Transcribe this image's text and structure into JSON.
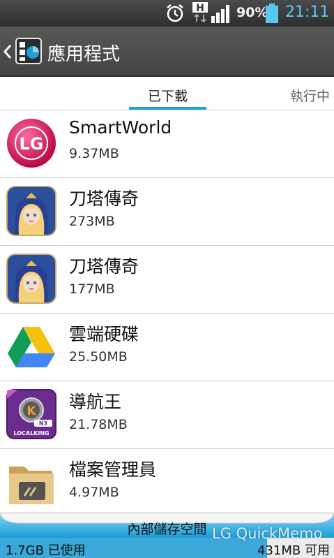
{
  "status_bar": {
    "battery_percent": "90%",
    "battery_level": 0.9,
    "time": "21:11",
    "network_label": "H",
    "icons": [
      "alarm-icon",
      "network-h-icon",
      "signal-icon",
      "battery-icon"
    ],
    "time_color": "#59c8ee"
  },
  "header": {
    "title": "應用程式",
    "icons": [
      "back-icon",
      "app-manager-icon"
    ]
  },
  "tabs": [
    {
      "label": "已下載",
      "selected": true
    },
    {
      "label": "執行中",
      "selected": false
    }
  ],
  "accent_color": "#1e9fd6",
  "apps": [
    {
      "name": "SmartWorld",
      "size": "9.37MB",
      "icon": "lg-smartworld-icon"
    },
    {
      "name": "刀塔傳奇",
      "size": "273MB",
      "icon": "dota-legend-icon"
    },
    {
      "name": "刀塔傳奇",
      "size": "177MB",
      "icon": "dota-legend-icon"
    },
    {
      "name": "雲端硬碟",
      "size": "25.50MB",
      "icon": "google-drive-icon"
    },
    {
      "name": "導航王",
      "size": "21.78MB",
      "icon": "localking-navigation-icon"
    },
    {
      "name": "檔案管理員",
      "size": "4.97MB",
      "icon": "file-manager-icon"
    }
  ],
  "storage": {
    "title": "內部儲存空間",
    "used": "1.7GB 已使用",
    "free": "431MB 可用",
    "used_fraction": 0.8
  },
  "watermark": "LG QuickMemo"
}
